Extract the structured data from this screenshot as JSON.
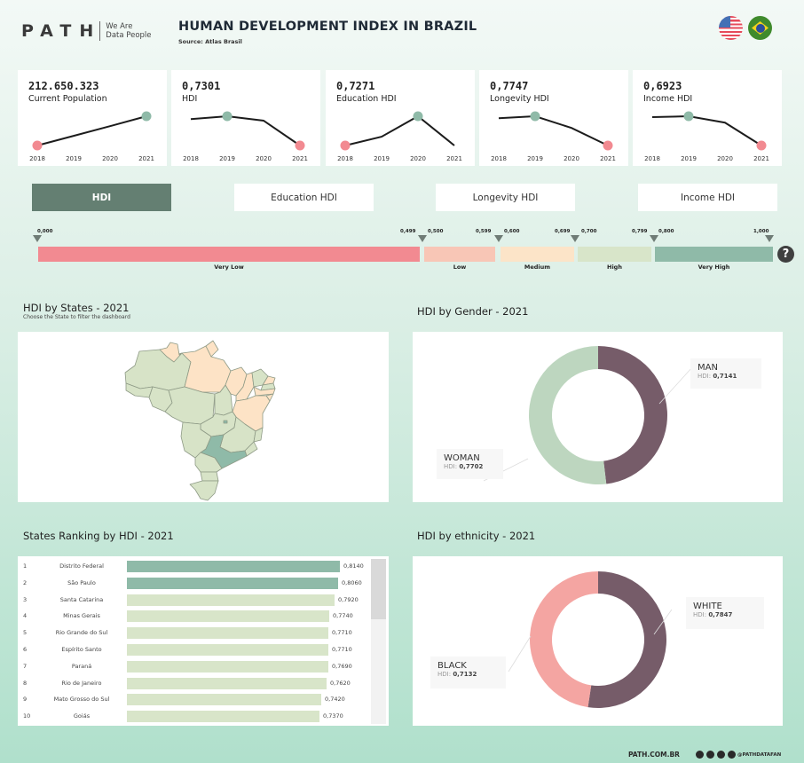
{
  "header": {
    "logo_text": "PATH",
    "logo_tagline_1": "We Are",
    "logo_tagline_2": "Data People",
    "title": "HUMAN DEVELOPMENT INDEX IN BRAZIL",
    "source": "Source: Atlas Brasil",
    "languages": [
      "English (US flag)",
      "Portuguese (Brazil flag)"
    ]
  },
  "kpis": [
    {
      "value": "212.650.323",
      "label": "Current Population",
      "years": [
        "2018",
        "2019",
        "2020",
        "2021"
      ],
      "trend": [
        0.0,
        0.33,
        0.66,
        1.0
      ],
      "high_year": "2021",
      "low_year": "2018"
    },
    {
      "value": "0,7301",
      "label": "HDI",
      "years": [
        "2018",
        "2019",
        "2020",
        "2021"
      ],
      "trend": [
        0.9,
        1.0,
        0.85,
        0.0
      ],
      "high_year": "2019",
      "low_year": "2021"
    },
    {
      "value": "0,7271",
      "label": "Education HDI",
      "years": [
        "2018",
        "2019",
        "2020",
        "2021"
      ],
      "trend": [
        0.0,
        0.3,
        1.0,
        0.0
      ],
      "high_year": "2020",
      "low_year": "2018"
    },
    {
      "value": "0,7747",
      "label": "Longevity HDI",
      "years": [
        "2018",
        "2019",
        "2020",
        "2021"
      ],
      "trend": [
        0.93,
        1.0,
        0.6,
        0.0
      ],
      "high_year": "2019",
      "low_year": "2021"
    },
    {
      "value": "0,6923",
      "label": "Income HDI",
      "years": [
        "2018",
        "2019",
        "2020",
        "2021"
      ],
      "trend": [
        0.97,
        1.0,
        0.78,
        0.0
      ],
      "high_year": "2019",
      "low_year": "2021"
    }
  ],
  "tabs": [
    {
      "label": "HDI",
      "active": true
    },
    {
      "label": "Education HDI",
      "active": false
    },
    {
      "label": "Longevity HDI",
      "active": false
    },
    {
      "label": "Income HDI",
      "active": false
    }
  ],
  "scale": {
    "segments": [
      {
        "label": "Very Low",
        "from": "0,000",
        "to": "0,499",
        "color": "#f28a91"
      },
      {
        "label": "Low",
        "from": "0,500",
        "to": "0,599",
        "color": "#f8c6b6"
      },
      {
        "label": "Medium",
        "from": "0,600",
        "to": "0,699",
        "color": "#fce4c8"
      },
      {
        "label": "High",
        "from": "0,700",
        "to": "0,799",
        "color": "#d8e5c9"
      },
      {
        "label": "Very High",
        "from": "0,800",
        "to": "1,000",
        "color": "#8fbaa8"
      }
    ],
    "help_label": "?"
  },
  "map": {
    "title": "HDI by States - 2021",
    "subtitle": "Choose the State to filter the dashboard"
  },
  "gender": {
    "title": "HDI by Gender - 2021",
    "slices": [
      {
        "name": "MAN",
        "hdi_label": "HDI:",
        "hdi": "0,7141",
        "value": 0.7141,
        "color": "#765c69"
      },
      {
        "name": "WOMAN",
        "hdi_label": "HDI:",
        "hdi": "0,7702",
        "value": 0.7702,
        "color": "#bdd6bf"
      }
    ]
  },
  "ranking": {
    "title": "States Ranking by HDI - 2021",
    "rows": [
      {
        "rank": "1",
        "state": "Distrito Federal",
        "value": "0,8140",
        "num": 0.814
      },
      {
        "rank": "2",
        "state": "São Paulo",
        "value": "0,8060",
        "num": 0.806
      },
      {
        "rank": "3",
        "state": "Santa Catarina",
        "value": "0,7920",
        "num": 0.792
      },
      {
        "rank": "4",
        "state": "Minas Gerais",
        "value": "0,7740",
        "num": 0.774
      },
      {
        "rank": "5",
        "state": "Rio Grande do Sul",
        "value": "0,7710",
        "num": 0.771
      },
      {
        "rank": "6",
        "state": "Espírito Santo",
        "value": "0,7710",
        "num": 0.771
      },
      {
        "rank": "7",
        "state": "Paraná",
        "value": "0,7690",
        "num": 0.769
      },
      {
        "rank": "8",
        "state": "Rio de Janeiro",
        "value": "0,7620",
        "num": 0.762
      },
      {
        "rank": "9",
        "state": "Mato Grosso do Sul",
        "value": "0,7420",
        "num": 0.742
      },
      {
        "rank": "10",
        "state": "Goiás",
        "value": "0,7370",
        "num": 0.737
      }
    ]
  },
  "ethnicity": {
    "title": "HDI by ethnicity - 2021",
    "slices": [
      {
        "name": "WHITE",
        "hdi_label": "HDI:",
        "hdi": "0,7847",
        "value": 0.7847,
        "color": "#765c69"
      },
      {
        "name": "BLACK",
        "hdi_label": "HDI:",
        "hdi": "0,7132",
        "value": 0.7132,
        "color": "#f4a5a2"
      }
    ]
  },
  "footer": {
    "site": "PATH.COM.BR",
    "handle": "@PATHDATAFAN",
    "social": [
      "github",
      "instagram",
      "linkedin",
      "facebook"
    ]
  },
  "colors": {
    "accent": "#647f72",
    "high_dot": "#8fbaa8",
    "low_dot": "#f28a91",
    "very_high": "#8fbaa8",
    "high": "#d8e5c9",
    "medium": "#fce4c8"
  }
}
